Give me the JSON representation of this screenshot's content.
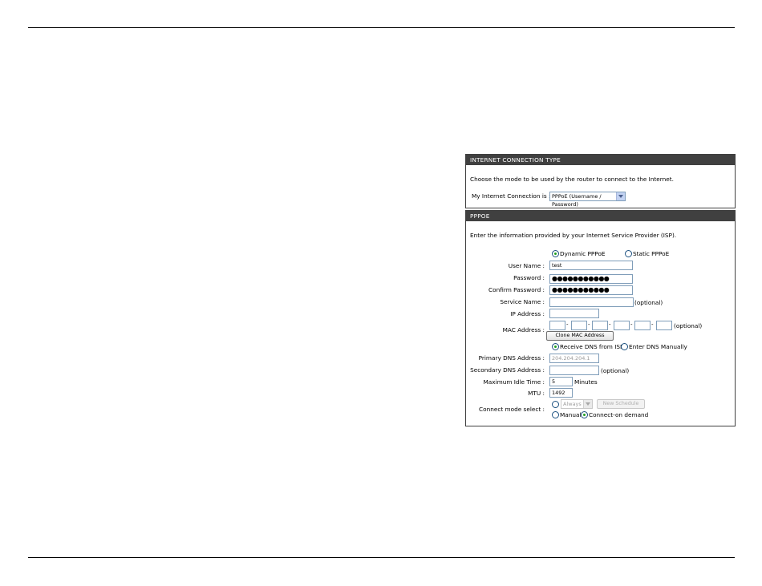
{
  "connection_type": {
    "header": "INTERNET CONNECTION TYPE",
    "description": "Choose the mode to be used by the router to connect to the Internet.",
    "label": "My Internet Connection is :",
    "selected": "PPPoE (Username / Password)"
  },
  "pppoe": {
    "header": "PPPOE",
    "description": "Enter the information provided by your Internet Service Provider (ISP).",
    "mode_dynamic": "Dynamic PPPoE",
    "mode_static": "Static PPPoE",
    "username_label": "User Name :",
    "username_value": "test",
    "password_label": "Password :",
    "password_value": "●●●●●●●●●●●",
    "confirm_label": "Confirm Password :",
    "confirm_value": "●●●●●●●●●●●",
    "service_label": "Service Name :",
    "optional_text": "(optional)",
    "ip_label": "IP Address :",
    "mac_label": "MAC Address :",
    "mac_optional": "(optional)",
    "mac_separator": "-",
    "clone_button": "Clone MAC Address",
    "dns_receive": "Receive DNS from ISP",
    "dns_manual": "Enter DNS Manually",
    "primary_dns_label": "Primary DNS Address :",
    "primary_dns_value": "204.204.204.1",
    "secondary_dns_label": "Secondary DNS Address :",
    "secondary_optional": "(optional)",
    "idle_label": "Maximum Idle Time :",
    "idle_value": "5",
    "idle_unit": "Minutes",
    "mtu_label": "MTU :",
    "mtu_value": "1492",
    "connect_label": "Connect mode select :",
    "schedule_value": "Always",
    "new_schedule_button": "New Schedule",
    "manual_label": "Manual",
    "on_demand_label": "Connect-on demand"
  }
}
